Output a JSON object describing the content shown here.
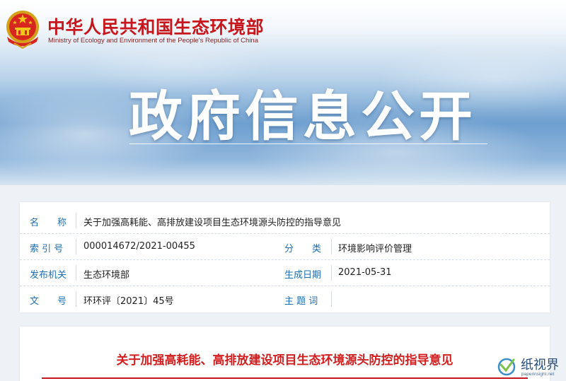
{
  "header": {
    "ministry_cn": "中华人民共和国生态环境部",
    "ministry_en": "Ministry of Ecology and Environment of the People's Republic of China",
    "banner_title": "政府信息公开"
  },
  "info": {
    "name_label": "名　　称",
    "name_value": "关于加强高耗能、高排放建设项目生态环境源头防控的指导意见",
    "index_label": "索 引 号",
    "index_value": "000014672/2021-00455",
    "category_label": "分　　类",
    "category_value": "环境影响评价管理",
    "issuer_label": "发布机关",
    "issuer_value": "生态环境部",
    "date_label": "生成日期",
    "date_value": "2021-05-31",
    "docno_label": "文　　号",
    "docno_value": "环环评〔2021〕45号",
    "keywords_label": "主 题 词",
    "keywords_value": ""
  },
  "article": {
    "title": "关于加强高耗能、高排放建设项目生态环境源头防控的指导意见"
  },
  "watermark": {
    "text": "纸视界",
    "sub": "paperinsight.net"
  },
  "colors": {
    "brand_red": "#c8161d",
    "label_blue": "#1f6fb4"
  }
}
